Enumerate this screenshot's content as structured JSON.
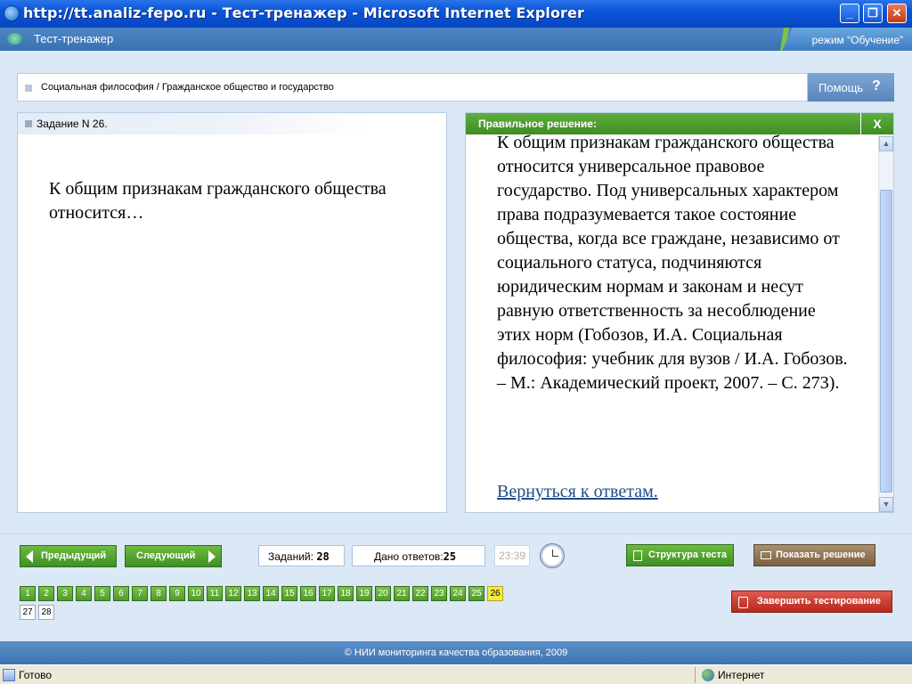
{
  "window": {
    "title": "http://tt.analiz-fepo.ru - Тест-тренажер - Microsoft Internet Explorer",
    "minimize": "_",
    "maximize": "❐",
    "close": "✕"
  },
  "appbar": {
    "title": "Тест-тренажер",
    "mode": "режим “Обучение”"
  },
  "breadcrumb": {
    "text": "Социальная философия / Гражданское общество и государство"
  },
  "help": {
    "label": "Помощь",
    "icon": "?"
  },
  "task": {
    "header": "Задание N 26.",
    "question": "К общим признакам гражданского общества относится…"
  },
  "solution": {
    "header": "Правильное решение:",
    "close": "X",
    "text": "К общим признакам гражданского общества относится универсальное правовое государство. Под универсальных характером права подразумевается такое состояние общества, когда все граждане, независимо от социального статуса, подчиняются юридическим нормам и законам и несут равную ответственность за несоблюдение этих норм (Гобозов, И.А. Социальная философия: учебник для вузов / И.А. Гобозов. – М.: Академический проект, 2007. – С. 273).",
    "back_link": "Вернуться к ответам."
  },
  "controls": {
    "prev": "Предыдущий",
    "next": "Следующий",
    "tasks_label": "Заданий:",
    "tasks_count": "28",
    "answers_label": "Дано ответов:",
    "answers_count": "25",
    "timer": "23:39",
    "structure": "Структура теста",
    "show_solution": "Показать решение",
    "finish": "Завершить тестирование"
  },
  "task_numbers": [
    "1",
    "2",
    "3",
    "4",
    "5",
    "6",
    "7",
    "8",
    "9",
    "10",
    "11",
    "12",
    "13",
    "14",
    "15",
    "16",
    "17",
    "18",
    "19",
    "20",
    "21",
    "22",
    "23",
    "24",
    "25",
    "26",
    "27",
    "28"
  ],
  "current_task": "26",
  "footer": "© НИИ мониторинга качества образования, 2009",
  "status": {
    "left": "Готово",
    "zone": "Интернет"
  },
  "colors": {
    "green": "#4e9a2e",
    "current": "#f5e84a",
    "brand_blue": "#3f74b2"
  }
}
